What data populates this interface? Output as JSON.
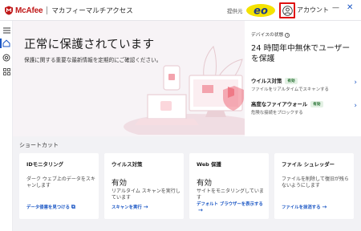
{
  "app": {
    "brand": "McAfee",
    "title": "マカフィーマルチアクセス",
    "provider_label": "提供元",
    "provider_logo": "eo",
    "account_label": "アカウント",
    "minimize_glyph": "—",
    "close_glyph": "✕"
  },
  "colors": {
    "brand_red": "#c01818",
    "accent_blue": "#1a56c4",
    "highlight_red": "#e01010",
    "badge_green": "#1d6b2a"
  },
  "sidebar": {
    "items": [
      {
        "icon": "menu-icon"
      },
      {
        "icon": "home-icon",
        "active": true
      },
      {
        "icon": "web-protection-icon"
      },
      {
        "icon": "apps-grid-icon"
      }
    ]
  },
  "hero": {
    "title": "正常に保護されています",
    "subtitle": "保護に関する重要な最新情報を定期的にご確認ください。"
  },
  "status_panel": {
    "label": "デバイスの状態",
    "info_glyph": "i",
    "headline": "24 時間年中無休でユーザーを保護",
    "features": [
      {
        "name": "ウイルス対策",
        "badge": "有効",
        "desc": "ファイルをリアルタイムでスキャンする",
        "chevron": "›"
      },
      {
        "name": "高度なファイアウォール",
        "badge": "有効",
        "desc": "危険な接続をブロックする",
        "chevron": "›"
      }
    ]
  },
  "shortcuts": {
    "title": "ショートカット",
    "cards": [
      {
        "title": "IDモニタリング",
        "status": "",
        "desc": "ダーク ウェブ上のデータをスキャンします",
        "link": "データ侵害を見つける",
        "link_icon": "external-link-icon"
      },
      {
        "title": "ウイルス対策",
        "status": "有効",
        "desc": "リアルタイム スキャンを実行しています",
        "link": "スキャンを実行",
        "link_icon": "arrow-right-icon"
      },
      {
        "title": "Web 保護",
        "status": "有効",
        "desc": "サイトをモニタリングしています",
        "link": "デフォルト ブラウザーを表示する",
        "link_icon": "arrow-right-icon"
      },
      {
        "title": "ファイル シュレッダー",
        "status": "",
        "desc": "ファイルを削除して復旧が残らないようにします",
        "link": "ファイルを抹消する",
        "link_icon": "arrow-right-icon"
      }
    ]
  }
}
